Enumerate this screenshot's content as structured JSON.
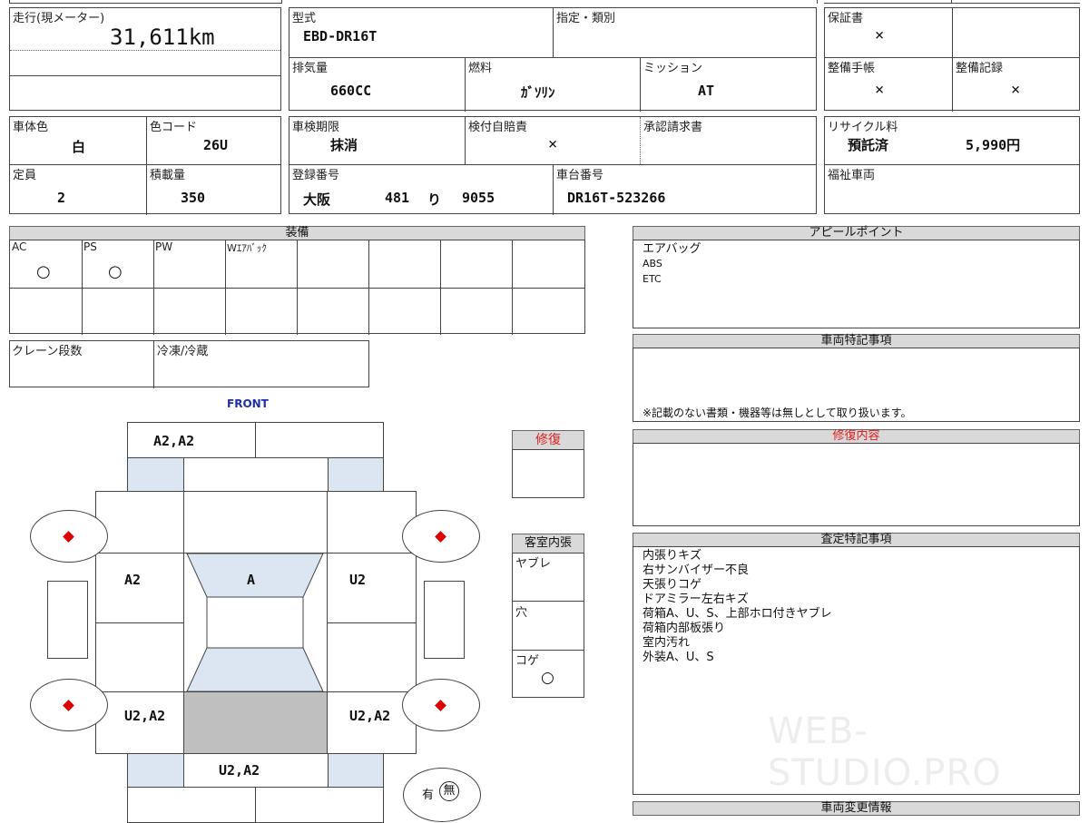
{
  "mileage": {
    "label": "走行(現メーター)",
    "value": "31,611km"
  },
  "model": {
    "label": "型式",
    "value": "EBD-DR16T"
  },
  "designation": {
    "label": "指定・類別",
    "value": ""
  },
  "warranty": {
    "label": "保証書",
    "value": "×"
  },
  "displacement": {
    "label": "排気量",
    "value": "660CC"
  },
  "fuel": {
    "label": "燃料",
    "value": "ｶﾞｿﾘﾝ"
  },
  "transmission": {
    "label": "ミッション",
    "value": "AT"
  },
  "maint_book": {
    "label": "整備手帳",
    "value": "×"
  },
  "maint_record": {
    "label": "整備記録",
    "value": "×"
  },
  "body_color": {
    "label": "車体色",
    "value": "白"
  },
  "color_code": {
    "label": "色コード",
    "value": "26U"
  },
  "inspection": {
    "label": "車検期限",
    "value": "抹消"
  },
  "insurance": {
    "label": "検付自賠責",
    "value": "×"
  },
  "approval": {
    "label": "承認請求書",
    "value": ""
  },
  "recycle": {
    "label": "リサイクル料",
    "status": "預託済",
    "amount": "5,990円"
  },
  "capacity": {
    "label": "定員",
    "value": "2"
  },
  "load": {
    "label": "積載量",
    "value": "350"
  },
  "registration": {
    "label": "登録番号",
    "region": "大阪",
    "class": "481",
    "kana": "り",
    "number": "9055"
  },
  "chassis": {
    "label": "車台番号",
    "value": "DR16T-523266"
  },
  "welfare": {
    "label": "福祉車両",
    "value": ""
  },
  "equipment": {
    "title": "装備",
    "items": [
      {
        "label": "AC",
        "mark": "○"
      },
      {
        "label": "PS",
        "mark": "○"
      },
      {
        "label": "PW",
        "mark": ""
      },
      {
        "label": "Wｴｱﾊﾞｯｸ",
        "mark": ""
      }
    ]
  },
  "crane": {
    "label": "クレーン段数"
  },
  "freezer": {
    "label": "冷凍/冷蔵"
  },
  "appeal": {
    "title": "アピールポイント",
    "line1": "エアバッグ",
    "line2": "ABS",
    "line3": "ETC"
  },
  "notes": {
    "title": "車両特記事項",
    "disclaimer": "※記載のない書類・機器等は無しとして取り扱います。"
  },
  "repair_detail": {
    "title": "修復内容"
  },
  "assessment": {
    "title": "査定特記事項",
    "lines": [
      "内張りキズ",
      "右サンバイザー不良",
      "天張りコゲ",
      "ドアミラー左右キズ",
      "荷箱A、U、S、上部ホロ付きヤブレ",
      "荷箱内部板張り",
      "室内汚れ",
      "外装A、U、S"
    ]
  },
  "change_info": {
    "title": "車両変更情報"
  },
  "repair": {
    "title": "修復"
  },
  "interior": {
    "title": "客室内張",
    "tear": "ヤブレ",
    "hole": "穴",
    "burn": "コゲ",
    "burn_mark": "○"
  },
  "diagram": {
    "front_label": "FRONT",
    "top": "A2,A2",
    "left_mid": "A2",
    "center": "A",
    "right_mid": "U2",
    "left_rear": "U2,A2",
    "right_rear": "U2,A2",
    "bottom": "U2,A2",
    "presence_yes": "有",
    "presence_no": "無"
  },
  "watermark": "WEB-STUDIO.PRO",
  "colors": {
    "header_bg": "#d9d9d9",
    "panel_blue": "#dce6f2",
    "damage_red": "#e00000",
    "front_blue": "#1f2fa8",
    "repair_red": "#e02020"
  }
}
